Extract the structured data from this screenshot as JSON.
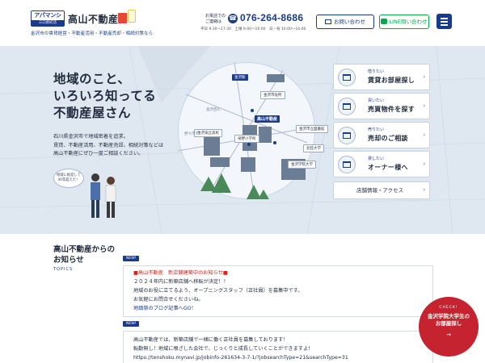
{
  "header": {
    "logo_badge_top": "アパマンショップ",
    "logo_badge_bottom": "三口新町店",
    "company_name": "高山不動産",
    "tagline": "金沢市の賃貸経営・不動産活用・不動産売却・相続対策なら",
    "phone_label": "お電話でのご連絡は",
    "phone_number": "076-264-8686",
    "phone_hours": "平日 9:30〜17:30　土曜 9:00〜16:00　日・祝 10:00〜16:00",
    "contact_button": "お問い合わせ",
    "line_button": "LINE問い合わせ"
  },
  "hero": {
    "title_line1": "地域のこと、",
    "title_line2": "いろいろ知ってる",
    "title_line3": "不動産屋さん",
    "desc_line1": "石川県金沢市で地域密着を追求。",
    "desc_line2": "賃貸、不動産活用、不動産売却、相続対策などは",
    "desc_line3": "高山不動産にぜひ一度ご相談ください。",
    "speech_line1": "地域に根差して",
    "speech_line2": "40年超えた！",
    "map_labels": {
      "station": "金沢駅",
      "city_hall": "金沢市役所",
      "company": "高山不動産",
      "arts_school": "金沢市立図書館",
      "higashi_hs": "金沢泉丘高校",
      "tobu_school": "泉野小学校",
      "hokuriku_univ": "北陸大学",
      "gakuin_univ": "金沢学院大学",
      "route1": "野々市市",
      "route2": "金沢西IC"
    },
    "nav": [
      {
        "sub": "借りたい",
        "main": "賃貸お部屋探し"
      },
      {
        "sub": "買いたい",
        "main": "売買物件を探す"
      },
      {
        "sub": "売りたい",
        "main": "売却のご相談"
      },
      {
        "sub": "貸したい",
        "main": "オーナー様へ"
      }
    ],
    "store_info": "店舗情報・アクセス"
  },
  "news": {
    "title_line1": "高山不動産からの",
    "title_line2": "お知らせ",
    "subtitle": "TOPICS",
    "items": [
      {
        "badge": "NEW!",
        "line1": "■高山不動産　新店舗建築中のお知らせ■",
        "line2": "２０２４年内に新築店舗へ移転が決定！！",
        "line3": "地域のお役に立てるよう、オープニングスタッフ（正社員）を募集中です。",
        "line4": "お気軽にお問合せくださいね。",
        "line5": "地鎮祭のブログ記事へGO！"
      },
      {
        "badge": "NEW!",
        "line1": "高山不動産では、新築店舗で一緒に働く正社員を募集しております！",
        "line2": "転勤無し！地域に根ざした会社で、じっくりと成長していくことができますよ！",
        "line3": "https://tenshoku.mynavi.jp/jobinfo-261634-3-7-1/?jobsearchType=21&searchType=31"
      }
    ]
  },
  "float_badge": {
    "check": "CHECK!",
    "line1": "金沢学院大学生の",
    "line2": "お部屋探し",
    "arrow": "→"
  },
  "colors": {
    "navy": "#1a3a8a",
    "red": "#c4232f",
    "line_green": "#06a84a",
    "hero_bg": "#dfe8f1"
  }
}
